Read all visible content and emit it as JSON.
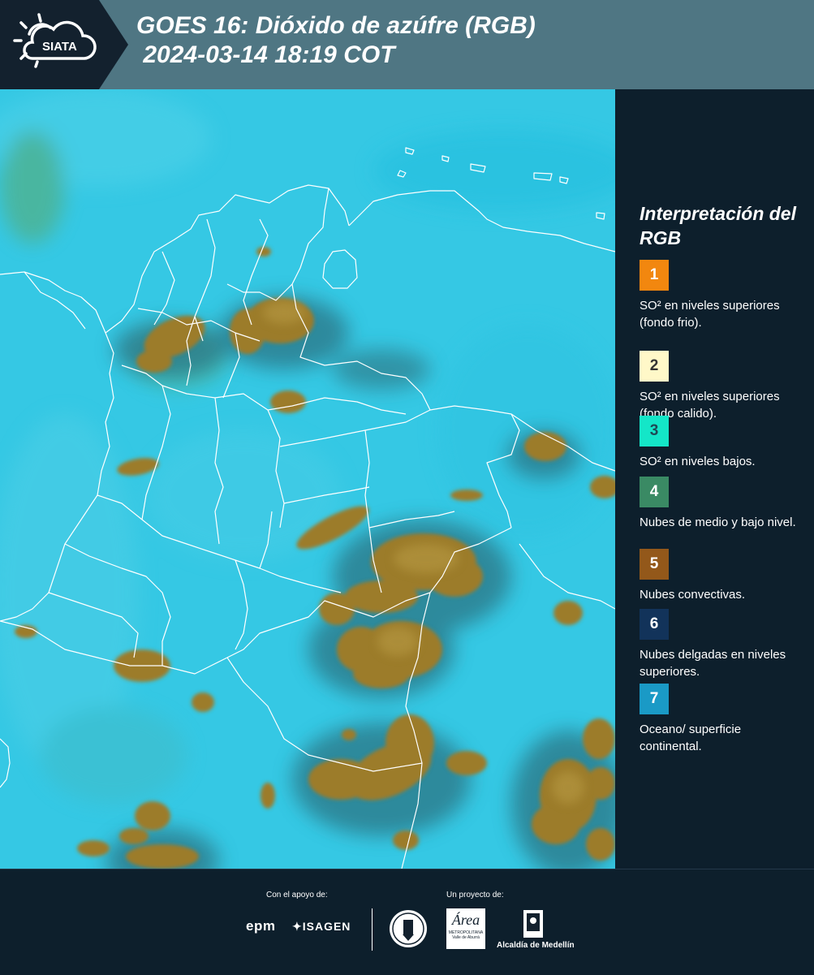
{
  "header": {
    "logo_text": "SIATA",
    "title": "GOES 16: Dióxido de azúfre (RGB)\n 2024-03-14 18:19 COT"
  },
  "legend": {
    "title": "Interpretación del RGB",
    "items": [
      {
        "number": "1",
        "color": "#f2870f",
        "numcolor": "#ffffff",
        "text": "SO² en niveles superiores (fondo frio)."
      },
      {
        "number": "2",
        "color": "#fff8c8",
        "numcolor": "#333333",
        "text": "SO² en niveles superiores (fondo calido)."
      },
      {
        "number": "3",
        "color": "#14e6c8",
        "numcolor": "#1e4a55",
        "text": "SO² en niveles bajos."
      },
      {
        "number": "4",
        "color": "#3a8a64",
        "numcolor": "#ffffff",
        "text": "Nubes de medio y bajo nivel."
      },
      {
        "number": "5",
        "color": "#93581a",
        "numcolor": "#ffffff",
        "text": "Nubes convectivas."
      },
      {
        "number": "6",
        "color": "#12335a",
        "numcolor": "#ffffff",
        "text": "Nubes delgadas en niveles superiores."
      },
      {
        "number": "7",
        "color": "#1a9ac6",
        "numcolor": "#ffffff",
        "text": "Oceano/ superficie continental."
      }
    ]
  },
  "footer": {
    "support_caption": "Con el apoyo de:",
    "project_caption": "Un proyecto de:",
    "logo_epm": "epm",
    "logo_isagen": "ISAGEN",
    "logo_area": "Área",
    "logo_area_sub": "METROPOLITANA",
    "logo_area_sub2": "Valle de Aburrá",
    "logo_alcaldia": "Alcaldía de Medellín"
  },
  "colors": {
    "header_bg": "#4f7683",
    "panel_bg": "#0d1f2c",
    "map_cyan": "#2cc6e4",
    "convective_cloud": "#9a7a2e"
  }
}
